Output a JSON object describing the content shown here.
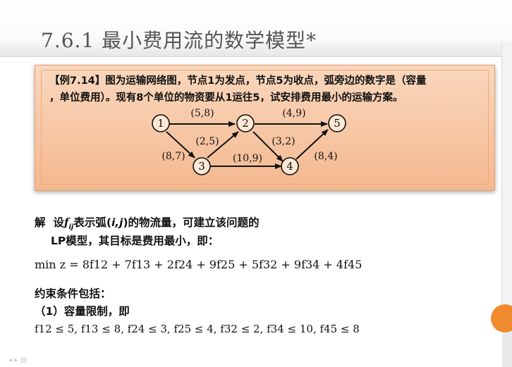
{
  "title": "7.6.1  最小费用流的数学模型*",
  "example": {
    "label": "【例7.14】",
    "text_line1": "图为运输网络图，节点1为发点，节点5为收点，弧旁边的数字是（容量",
    "text_line2": "，单位费用）。现有8个单位的物资要从1运往5，试安排费用最小的运输方案。"
  },
  "network": {
    "nodes": [
      "1",
      "2",
      "3",
      "4",
      "5"
    ],
    "arcs": [
      {
        "from": "1",
        "to": "2",
        "label": "(5,8)"
      },
      {
        "from": "1",
        "to": "3",
        "label": "(8,7)"
      },
      {
        "from": "3",
        "to": "2",
        "label": "(2,5)"
      },
      {
        "from": "2",
        "to": "5",
        "label": "(4,9)"
      },
      {
        "from": "2",
        "to": "4",
        "label": "(3,2)"
      },
      {
        "from": "3",
        "to": "4",
        "label": "(10,9)"
      },
      {
        "from": "4",
        "to": "5",
        "label": "(8,4)"
      }
    ]
  },
  "solution": {
    "lead": "解",
    "line1_a": "设",
    "line1_var": "f",
    "line1_sub": "ij",
    "line1_b": "表示弧(",
    "line1_ij": "i,j",
    "line1_c": ")的物流量，可建立该问题的",
    "line2": "LP模型，其目标是费用最小，即：",
    "objective": "min z = 8f12 + 7f13 + 2f24 + 9f25 + 5f32 + 9f34 + 4f45",
    "constraints_heading": "约束条件包括：",
    "capacity_heading": "（1）容量限制，即",
    "capacity_constraints": "f12 ≤ 5, f13 ≤ 8, f24 ≤ 3, f25 ≤ 4, f32 ≤ 2, f34 ≤ 10, f45 ≤ 8"
  },
  "colors": {
    "accent_orange": "#f08a2e",
    "box_top": "#f9d7bd",
    "box_bottom": "#f4b88f"
  }
}
